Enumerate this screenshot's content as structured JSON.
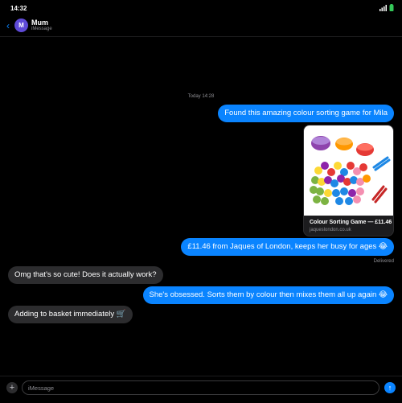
{
  "status_bar": {
    "time": "14:32"
  },
  "header": {
    "back_icon": "chevron-left-icon",
    "avatar_initial": "M",
    "contact_name": "Mum",
    "service": "iMessage"
  },
  "thread": {
    "timestamp": "Today 14:28",
    "messages": [
      {
        "direction": "outgoing",
        "text": "Found this amazing colour sorting game for Mila"
      },
      {
        "direction": "outgoing",
        "text": "£11.46 from Jaques of London, keeps her busy for ages 😂"
      },
      {
        "direction": "incoming",
        "text": "Omg that's so cute! Does it actually work?"
      },
      {
        "direction": "outgoing",
        "text": "She's obsessed. Sorts them by colour then mixes them all up again 😂"
      },
      {
        "direction": "incoming",
        "text": "Adding to basket immediately 🛒"
      }
    ],
    "link_preview": {
      "title": "Colour Sorting Game — £11.46",
      "domain": "jaqueslondon.co.uk"
    },
    "delivered": "Delivered"
  },
  "composer": {
    "placeholder": "iMessage",
    "plus_icon": "plus-icon",
    "send_icon": "arrow-up-icon"
  },
  "colors": {
    "accent": "#0a84ff",
    "incoming_bubble": "#2c2c2e",
    "avatar": "#5e4ad6"
  }
}
